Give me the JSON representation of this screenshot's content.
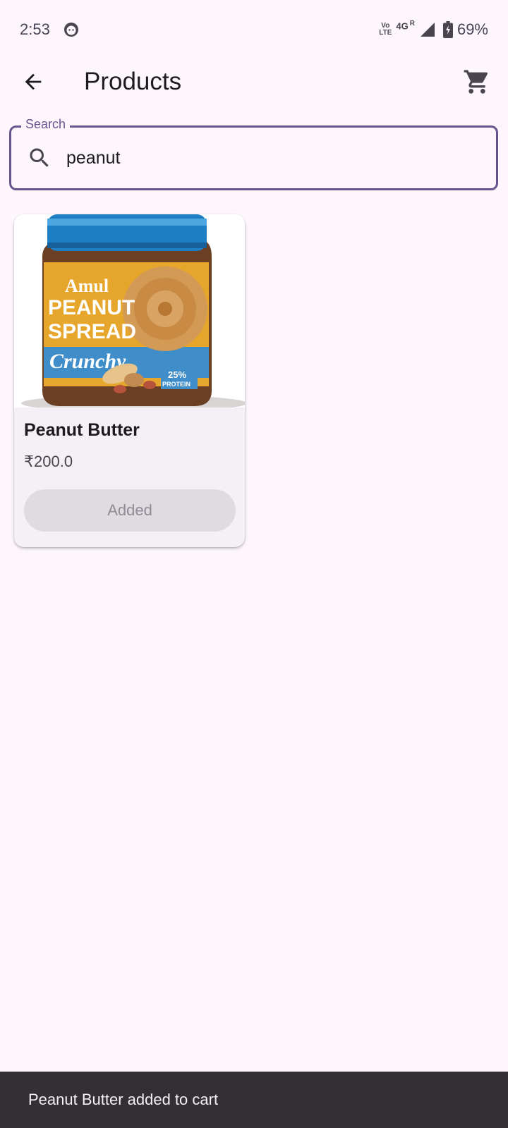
{
  "status_bar": {
    "time": "2:53",
    "volte_top": "Vo",
    "volte_bottom": "LTE",
    "network": "4G",
    "roaming": "R",
    "battery": "69%",
    "icons": [
      "app-face-icon",
      "signal-icon",
      "battery-charging-icon"
    ]
  },
  "app_bar": {
    "title": "Products",
    "back_icon": "arrow-back-icon",
    "cart_icon": "shopping-cart-icon"
  },
  "search": {
    "label": "Search",
    "value": "peanut",
    "icon": "search-icon"
  },
  "products": [
    {
      "name": "Peanut Butter",
      "price": "₹200.0",
      "button_label": "Added",
      "image": {
        "brand": "Amul",
        "line1": "PEANUT",
        "line2": "SPREAD",
        "variant": "Crunchy",
        "badge_top": "25%",
        "badge_bottom": "PROTEIN"
      }
    }
  ],
  "snackbar": {
    "message": "Peanut Butter added to cart"
  },
  "colors": {
    "background": "#fdf7fd",
    "accent": "#65558f",
    "card": "#f5f0f6",
    "snackbar": "#322f35"
  }
}
